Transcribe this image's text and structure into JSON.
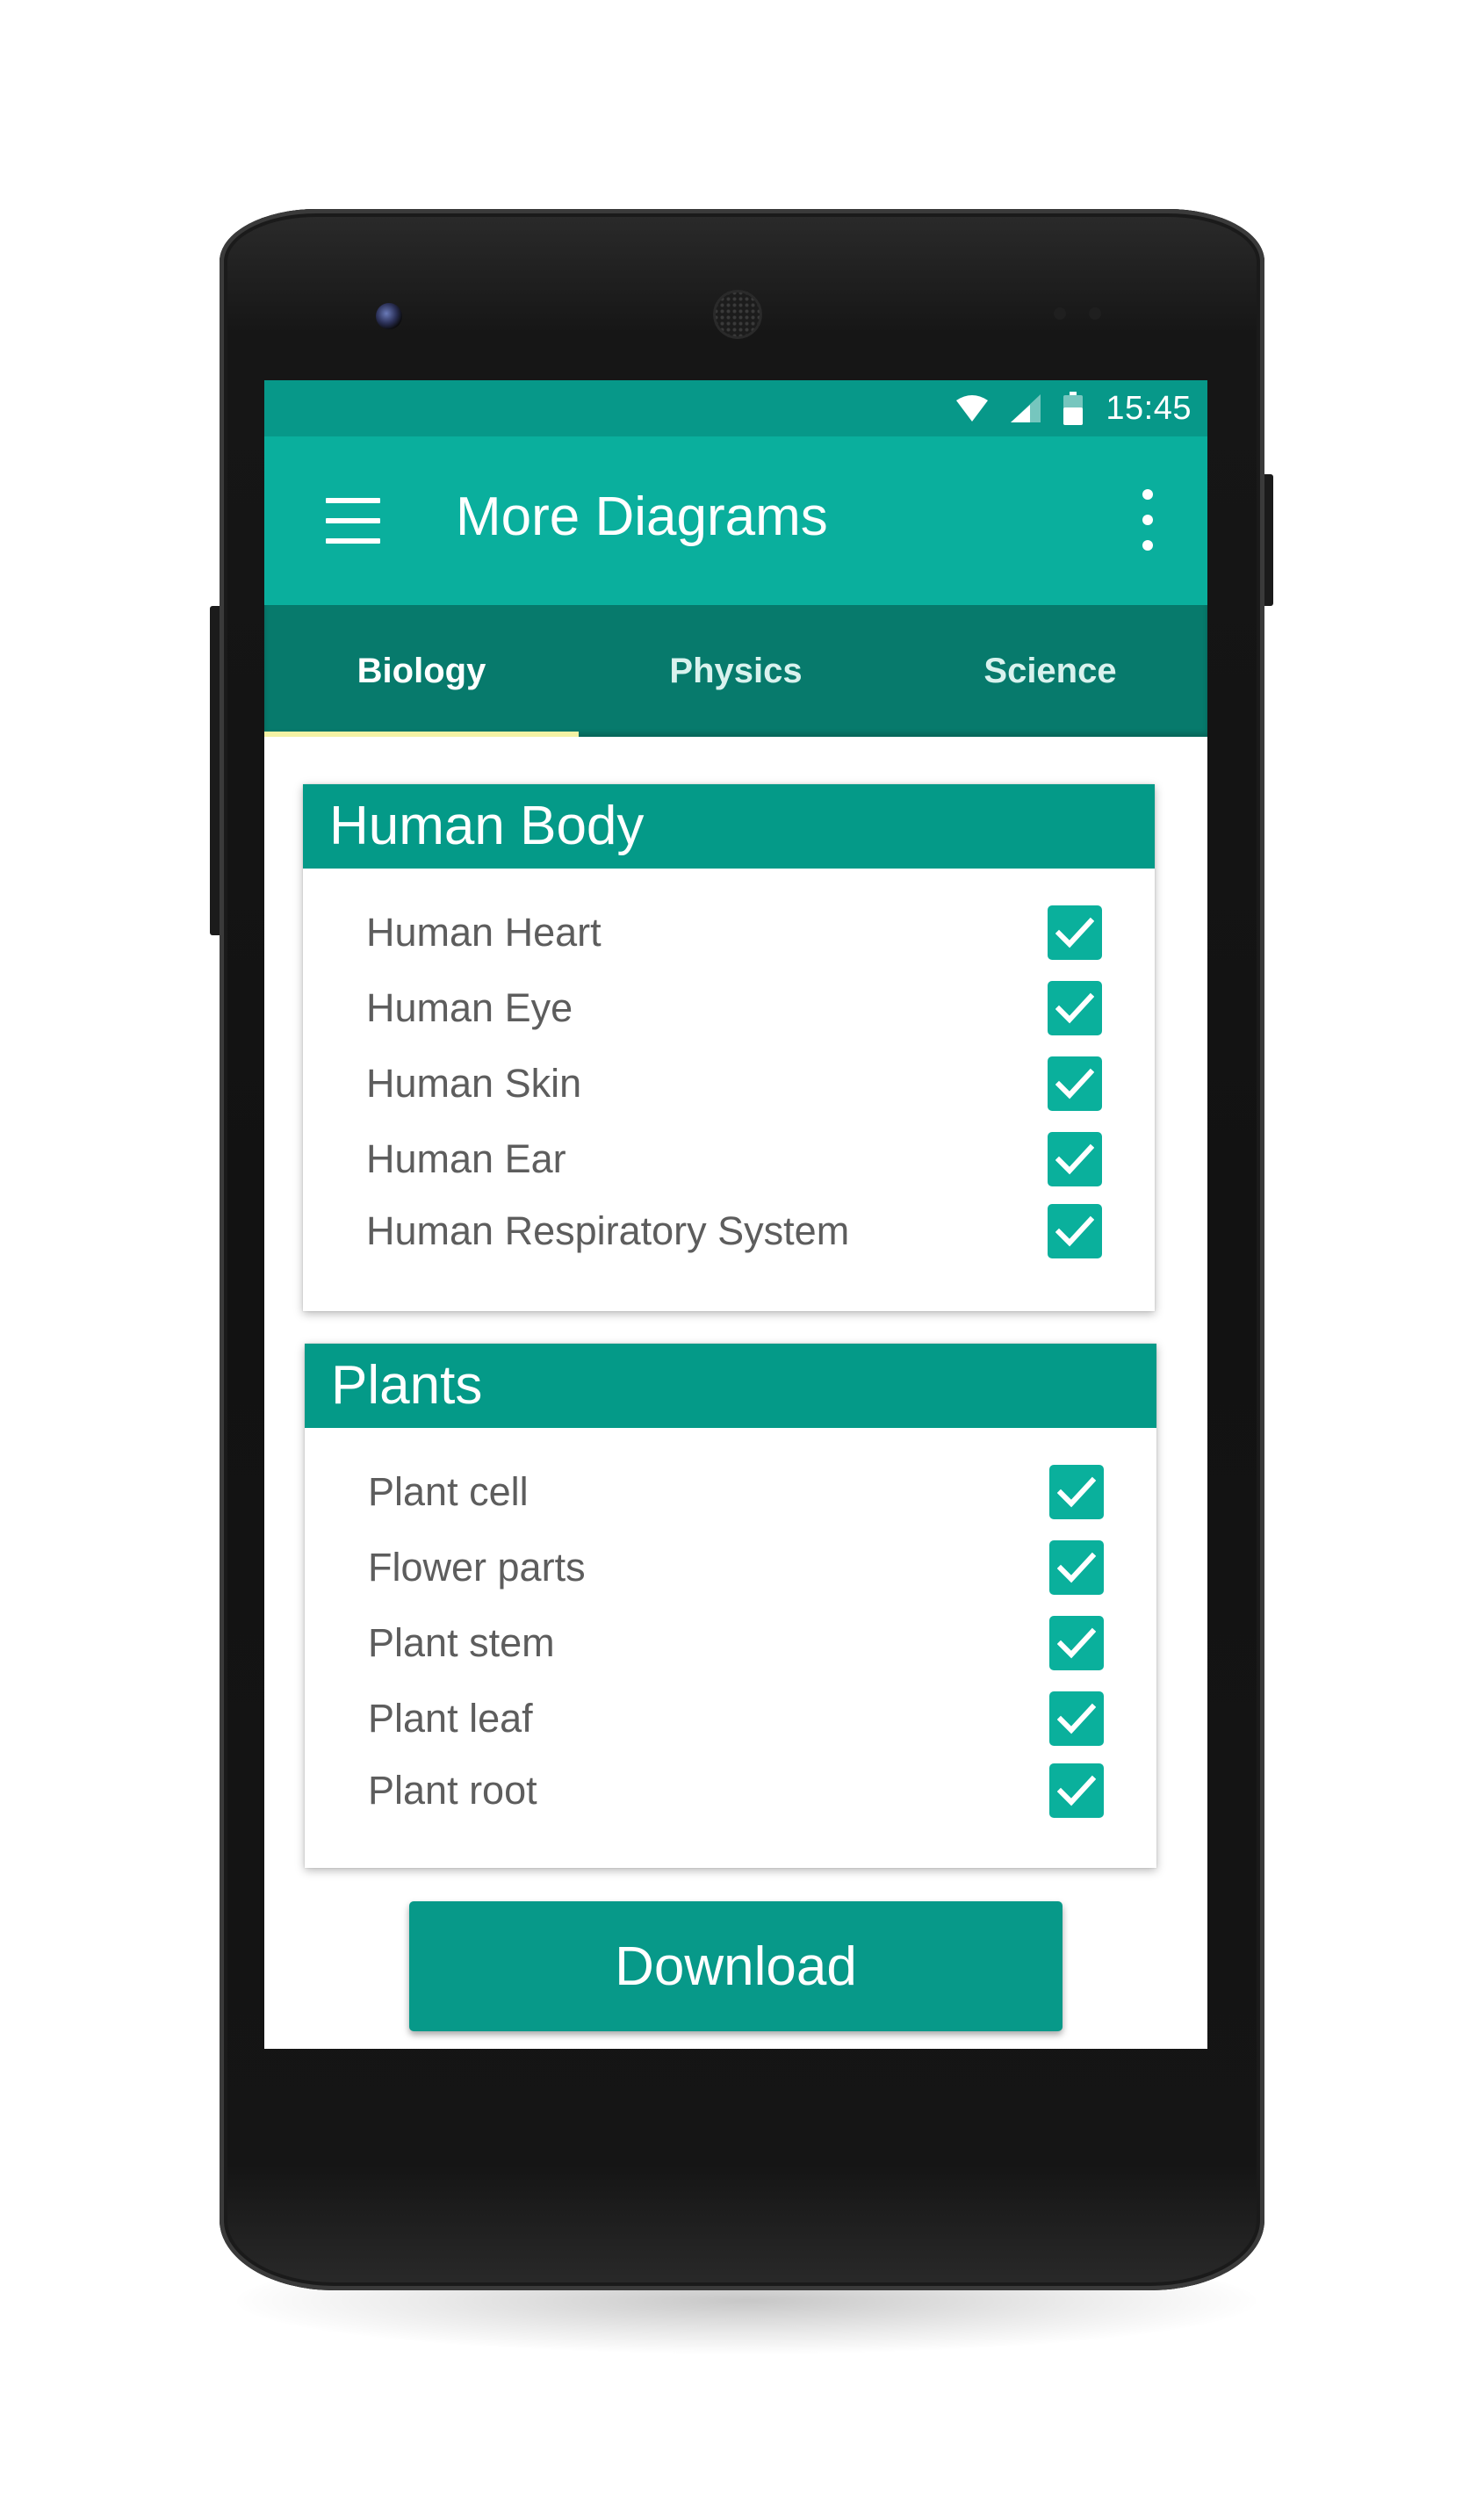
{
  "status_bar": {
    "time": "15:45",
    "icons": [
      "wifi-icon",
      "signal-icon",
      "battery-icon"
    ]
  },
  "app_bar": {
    "title": "More Diagrams",
    "menu_icon": "hamburger-menu-icon",
    "overflow_icon": "more-vert-icon"
  },
  "tabs": [
    {
      "label": "Biology",
      "active": true
    },
    {
      "label": "Physics",
      "active": false
    },
    {
      "label": "Science",
      "active": false
    }
  ],
  "sections": [
    {
      "title": "Human Body",
      "items": [
        {
          "label": "Human Heart",
          "checked": true
        },
        {
          "label": "Human Eye",
          "checked": true
        },
        {
          "label": "Human Skin",
          "checked": true
        },
        {
          "label": "Human Ear",
          "checked": true
        },
        {
          "label": "Human Respiratory System",
          "checked": true
        }
      ]
    },
    {
      "title": "Plants",
      "items": [
        {
          "label": "Plant cell",
          "checked": true
        },
        {
          "label": "Flower parts",
          "checked": true
        },
        {
          "label": "Plant stem",
          "checked": true
        },
        {
          "label": "Plant leaf",
          "checked": true
        },
        {
          "label": "Plant root",
          "checked": true
        }
      ]
    }
  ],
  "download_button": {
    "label": "Download"
  },
  "colors": {
    "status_bar": "#079889",
    "app_bar": "#0aaf9d",
    "tab_bar": "#077a6c",
    "tab_indicator": "#f4f2a4",
    "card_header": "#049a88",
    "checkbox": "#0ab09c",
    "button": "#079989"
  }
}
